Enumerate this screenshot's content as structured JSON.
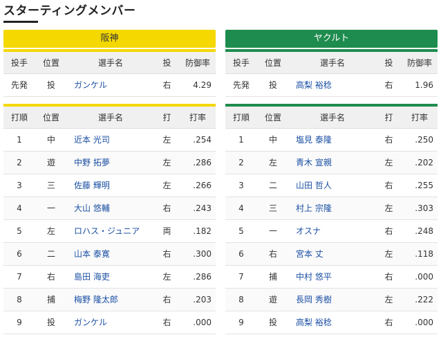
{
  "page": {
    "title": "スターティングメンバー"
  },
  "teams": {
    "left": {
      "name": "阪神",
      "pitcher_headers": [
        "投手",
        "位置",
        "選手名",
        "投",
        "防御率"
      ],
      "pitcher": {
        "role": "先発",
        "pos": "投",
        "name": "ガンケル",
        "hand": "右",
        "era": "4.29"
      },
      "batting_headers": [
        "打順",
        "位置",
        "選手名",
        "打",
        "打率"
      ],
      "lineup": [
        {
          "order": "1",
          "pos": "中",
          "name": "近本 光司",
          "bat": "左",
          "avg": ".254"
        },
        {
          "order": "2",
          "pos": "遊",
          "name": "中野 拓夢",
          "bat": "左",
          "avg": ".286"
        },
        {
          "order": "3",
          "pos": "三",
          "name": "佐藤 輝明",
          "bat": "左",
          "avg": ".266"
        },
        {
          "order": "4",
          "pos": "一",
          "name": "大山 悠輔",
          "bat": "右",
          "avg": ".243"
        },
        {
          "order": "5",
          "pos": "左",
          "name": "ロハス・ジュニア",
          "bat": "両",
          "avg": ".182"
        },
        {
          "order": "6",
          "pos": "二",
          "name": "山本 泰寛",
          "bat": "右",
          "avg": ".300"
        },
        {
          "order": "7",
          "pos": "右",
          "name": "島田 海吏",
          "bat": "左",
          "avg": ".286"
        },
        {
          "order": "8",
          "pos": "捕",
          "name": "梅野 隆太郎",
          "bat": "右",
          "avg": ".203"
        },
        {
          "order": "9",
          "pos": "投",
          "name": "ガンケル",
          "bat": "右",
          "avg": ".000"
        }
      ]
    },
    "right": {
      "name": "ヤクルト",
      "pitcher_headers": [
        "投手",
        "位置",
        "選手名",
        "投",
        "防御率"
      ],
      "pitcher": {
        "role": "先発",
        "pos": "投",
        "name": "高梨 裕稔",
        "hand": "右",
        "era": "1.96"
      },
      "batting_headers": [
        "打順",
        "位置",
        "選手名",
        "打",
        "打率"
      ],
      "lineup": [
        {
          "order": "1",
          "pos": "中",
          "name": "塩見 泰隆",
          "bat": "右",
          "avg": ".250"
        },
        {
          "order": "2",
          "pos": "左",
          "name": "青木 宣親",
          "bat": "左",
          "avg": ".202"
        },
        {
          "order": "3",
          "pos": "二",
          "name": "山田 哲人",
          "bat": "右",
          "avg": ".255"
        },
        {
          "order": "4",
          "pos": "三",
          "name": "村上 宗隆",
          "bat": "左",
          "avg": ".303"
        },
        {
          "order": "5",
          "pos": "一",
          "name": "オスナ",
          "bat": "右",
          "avg": ".248"
        },
        {
          "order": "6",
          "pos": "右",
          "name": "宮本 丈",
          "bat": "左",
          "avg": ".118"
        },
        {
          "order": "7",
          "pos": "捕",
          "name": "中村 悠平",
          "bat": "右",
          "avg": ".000"
        },
        {
          "order": "8",
          "pos": "遊",
          "name": "長岡 秀樹",
          "bat": "左",
          "avg": ".222"
        },
        {
          "order": "9",
          "pos": "投",
          "name": "高梨 裕稔",
          "bat": "右",
          "avg": ".000"
        }
      ]
    }
  },
  "colors": {
    "hanshin": "#f4d800",
    "yakult": "#1e8c4e",
    "player_link": "#1a4fa3"
  }
}
